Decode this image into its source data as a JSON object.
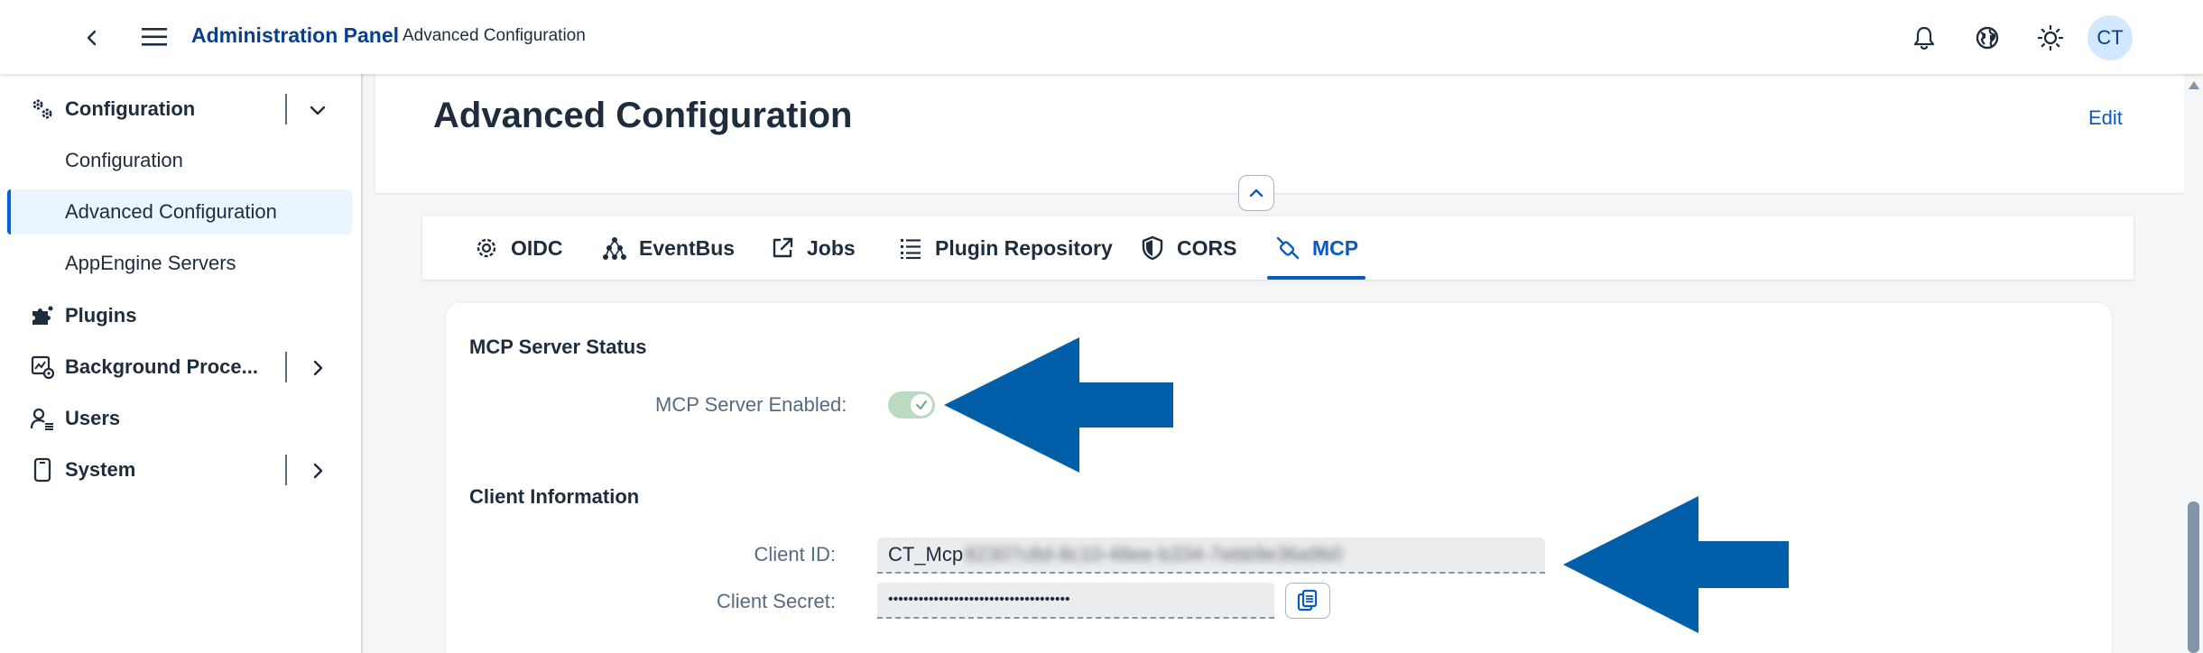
{
  "shell": {
    "title": "Administration Panel",
    "subtitle": "Advanced Configuration",
    "avatar_initials": "CT",
    "icons": [
      "back-icon",
      "menu-icon",
      "bell-icon",
      "globe-icon",
      "theme-icon"
    ]
  },
  "sidebar": {
    "items": [
      {
        "label": "Configuration",
        "icon": "gears-icon",
        "expanded": true
      },
      {
        "label": "Configuration"
      },
      {
        "label": "Advanced Configuration",
        "selected": true
      },
      {
        "label": "AppEngine Servers"
      },
      {
        "label": "Plugins",
        "icon": "puzzle-icon"
      },
      {
        "label": "Background Proce...",
        "icon": "process-icon",
        "expandable": true
      },
      {
        "label": "Users",
        "icon": "users-icon"
      },
      {
        "label": "System",
        "icon": "device-icon",
        "expandable": true
      }
    ]
  },
  "page": {
    "title": "Advanced Configuration",
    "edit_label": "Edit"
  },
  "tabs": [
    {
      "label": "OIDC",
      "icon": "settings-icon"
    },
    {
      "label": "EventBus",
      "icon": "network-icon"
    },
    {
      "label": "Jobs",
      "icon": "share-icon"
    },
    {
      "label": "Plugin Repository",
      "icon": "list-icon"
    },
    {
      "label": "CORS",
      "icon": "shield-icon"
    },
    {
      "label": "MCP",
      "icon": "connector-icon",
      "active": true
    }
  ],
  "mcp": {
    "status_title": "MCP Server Status",
    "enabled_label": "MCP Server Enabled:",
    "enabled": true,
    "client_title": "Client Information",
    "client_id_label": "Client ID:",
    "client_id_prefix": "CT_Mcp",
    "client_id_obscured": "82307c8d-8c10-48ee-b334-7ebb9e36a9b0",
    "client_secret_label": "Client Secret:",
    "client_secret_value": "••••••••••••••••••••••••••••••••••••"
  },
  "colors": {
    "accent": "#0a5bbf",
    "annotation_arrow": "#005fa8",
    "toggle_on": "#bcd9c2"
  }
}
